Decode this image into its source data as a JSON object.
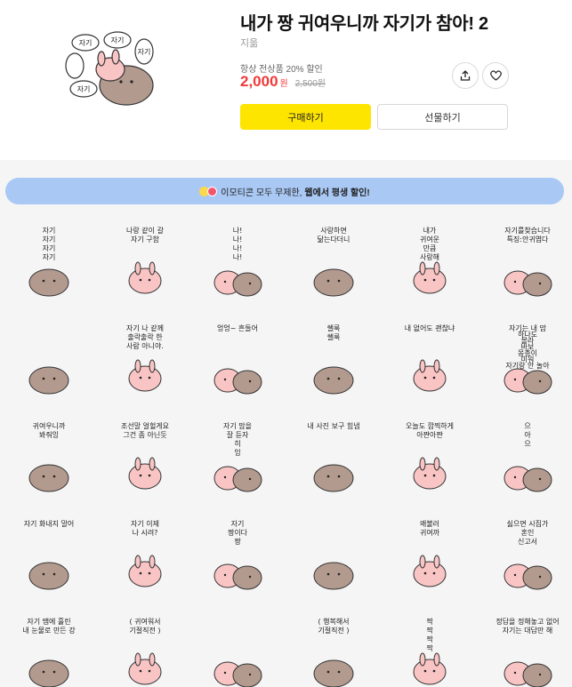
{
  "product": {
    "title": "내가 짱 귀여우니까 자기가 참아! 2",
    "author": "지읆",
    "discount_note": "항상 전상품 20% 할인",
    "price": "2,000",
    "price_unit": "원",
    "original_price": "2,500원",
    "buy_label": "구매하기",
    "gift_label": "선물하기",
    "thumbnail_texts": [
      "자기",
      "자기",
      "자기",
      "자기"
    ]
  },
  "promo": {
    "text_pre": "이모티콘 모두 무제한,",
    "text_em": "웹에서 평생 할인!"
  },
  "stickers": [
    {
      "name": "sticker-jagi-jagi",
      "texts": [
        "자기",
        "자기",
        "자기",
        "자기"
      ]
    },
    {
      "name": "sticker-go-together",
      "texts": [
        "나랑 같이 갈",
        "자기 구함"
      ]
    },
    {
      "name": "sticker-na-na",
      "texts": [
        "나!",
        "나!",
        "나!",
        "나!"
      ]
    },
    {
      "name": "sticker-love-you",
      "texts": [
        "사랑하면",
        "닮는다더니"
      ]
    },
    {
      "name": "sticker-earth-love",
      "texts": [
        "내가",
        "귀여운",
        "만큼",
        "사랑해"
      ]
    },
    {
      "name": "sticker-looking-for-jagi",
      "texts": [
        "자기를찾습니다",
        "특징:안귀엽다"
      ]
    },
    {
      "name": "sticker-big-heart",
      "texts": []
    },
    {
      "name": "sticker-jagi-sheep",
      "texts": [
        "자기 나 같께",
        "출락출락 한",
        "사람 아니야."
      ]
    },
    {
      "name": "sticker-pouting",
      "texts": [
        "엉엉~ 흔들어"
      ]
    },
    {
      "name": "sticker-shy",
      "texts": [
        "쌜룩",
        "쌜룩"
      ]
    },
    {
      "name": "sticker-peek",
      "texts": [
        "내 없어도 괜찮냐"
      ]
    },
    {
      "name": "sticker-whisper",
      "texts": [
        "자기는 내 맘",
        "하나도",
        "몰라",
        "바보",
        "몽총이",
        "미워",
        "자기랑 안 놀아"
      ]
    },
    {
      "name": "sticker-cute-wink",
      "texts": [
        "귀여우니까",
        "봐줘잉"
      ]
    },
    {
      "name": "sticker-typing",
      "texts": [
        "조선말 얼헐게요",
        "그건 좀 아닌듯"
      ]
    },
    {
      "name": "sticker-sign",
      "texts": [
        "자기 맘을",
        "잘 듣자",
        "히",
        "잉"
      ]
    },
    {
      "name": "sticker-photo",
      "texts": [
        "내 사진 보구 힘냄"
      ]
    },
    {
      "name": "sticker-twins",
      "texts": [
        "오늘도 깜찍하게",
        "아쨘아쨘"
      ]
    },
    {
      "name": "sticker-fire",
      "texts": [
        "으",
        "아",
        "으"
      ]
    },
    {
      "name": "sticker-hug-me",
      "texts": [
        "자기 화내지 말어"
      ]
    },
    {
      "name": "sticker-cold-now",
      "texts": [
        "자기 이제",
        "나 시려?"
      ]
    },
    {
      "name": "sticker-thumbs",
      "texts": [
        "자기",
        "짱이다",
        "짱"
      ]
    },
    {
      "name": "sticker-heart-hug",
      "texts": []
    },
    {
      "name": "sticker-why",
      "texts": [
        "왜불러",
        "귀여까"
      ]
    },
    {
      "name": "sticker-hate-tired",
      "texts": [
        "싫으면 시집가",
        "혼인",
        "신고서"
      ]
    },
    {
      "name": "sticker-river",
      "texts": [
        "자기 땜에 흘린",
        "내 눈물로 만든 강"
      ]
    },
    {
      "name": "sticker-cute-now",
      "texts": [
        "( 귀여워서",
        "기절직전 )"
      ]
    },
    {
      "name": "sticker-dizzy",
      "texts": []
    },
    {
      "name": "sticker-happy-dizzy",
      "texts": [
        "( 행복해서",
        "기절직전 )"
      ]
    },
    {
      "name": "sticker-slap",
      "texts": [
        "짝",
        "짝",
        "짝",
        "짝"
      ]
    },
    {
      "name": "sticker-answer",
      "texts": [
        "정답을 정해놓고 없어",
        "자기는 대답만 해"
      ]
    }
  ],
  "colors": {
    "accent_yellow": "#fee500",
    "price_red": "#f03a3a",
    "promo_blue": "#a9c8f4",
    "bear_brown": "#b29a8f",
    "pink_bunny": "#f9c4c4",
    "background_gray": "#f5f5f5"
  },
  "icons": {
    "share": "share-icon",
    "like": "heart-icon"
  }
}
